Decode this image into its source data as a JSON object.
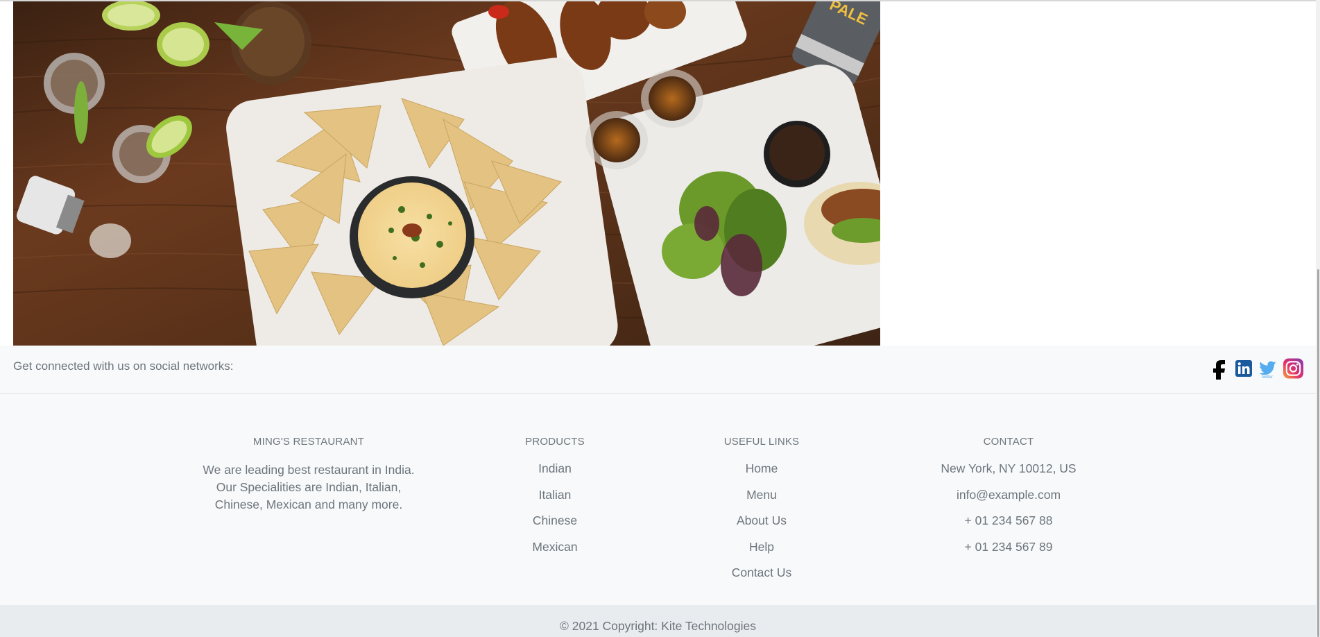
{
  "hero": {
    "alt": "Restaurant table with nachos, wings, salad and drinks"
  },
  "social": {
    "text": "Get connected with us on social networks:",
    "icons": [
      "facebook-icon",
      "linkedin-icon",
      "twitter-icon",
      "instagram-icon"
    ]
  },
  "footer": {
    "about": {
      "title": "MING'S RESTAURANT",
      "text": "We are leading best restaurant in India. Our Specialities are Indian, Italian, Chinese, Mexican and many more."
    },
    "products": {
      "title": "PRODUCTS",
      "items": [
        "Indian",
        "Italian",
        "Chinese",
        "Mexican"
      ]
    },
    "useful_links": {
      "title": "USEFUL LINKS",
      "items": [
        "Home",
        "Menu",
        "About Us",
        "Help",
        "Contact Us"
      ]
    },
    "contact": {
      "title": "CONTACT",
      "items": [
        "New York, NY 10012, US",
        "info@example.com",
        "+ 01 234 567 88",
        "+ 01 234 567 89"
      ]
    }
  },
  "copyright": "© 2021 Copyright: Kite Technologies",
  "colors": {
    "footer_bg": "#f8f9fa",
    "copyright_bg": "#e9ecef",
    "text": "#6c757d"
  }
}
